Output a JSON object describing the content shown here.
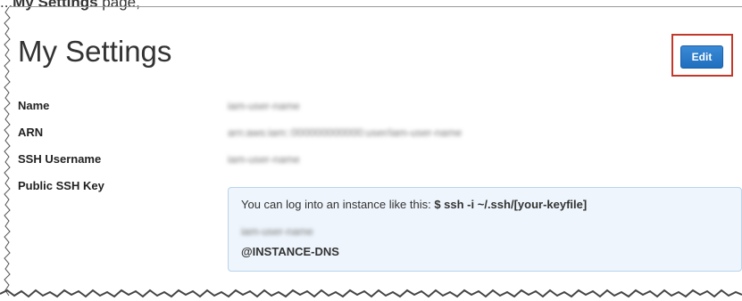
{
  "caption": {
    "prefix": "...",
    "bold": "My Settings",
    "suffix": " page,"
  },
  "header": {
    "title": "My Settings",
    "edit_label": "Edit"
  },
  "fields": [
    {
      "label": "Name",
      "value": "iam-user-name"
    },
    {
      "label": "ARN",
      "value": "arn:aws:iam::000000000000:user/iam-user-name"
    },
    {
      "label": "SSH Username",
      "value": "iam-user-name"
    },
    {
      "label": "Public SSH Key"
    }
  ],
  "ssh": {
    "intro": "You can log into an instance like this: ",
    "command": "$ ssh -i ~/.ssh/[your-keyfile]",
    "user": "iam-user-name",
    "dns": "@INSTANCE-DNS"
  },
  "colors": {
    "highlight": "#c0392b",
    "button": "#1f6fbf",
    "info_box_bg": "#eef5fc"
  }
}
